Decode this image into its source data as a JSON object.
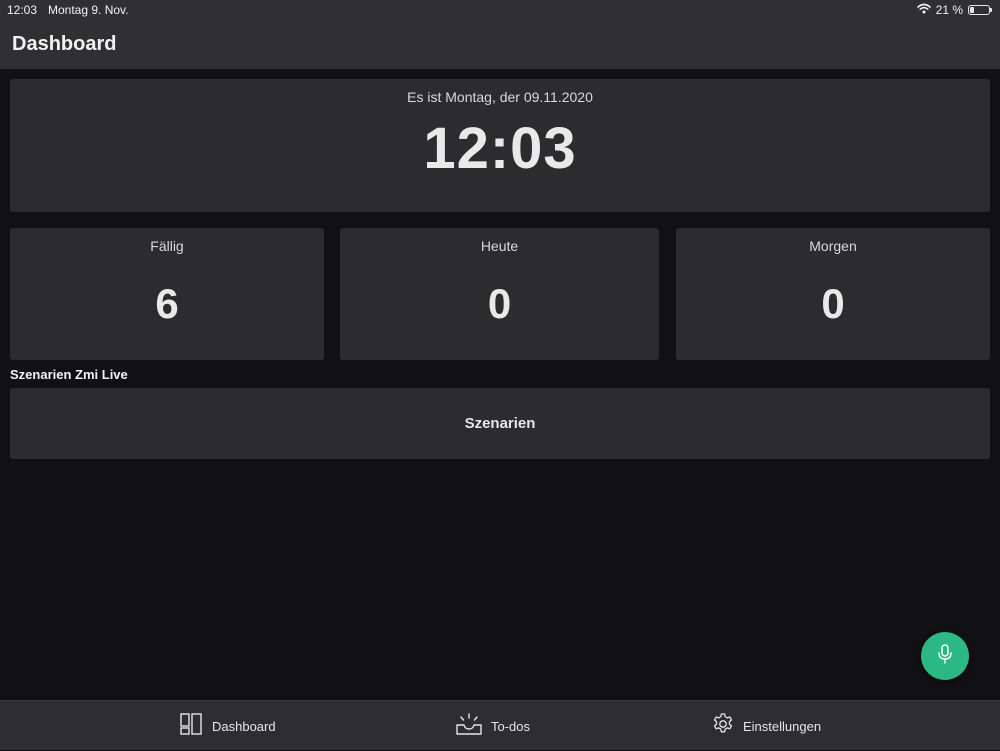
{
  "status_bar": {
    "time": "12:03",
    "date": "Montag 9. Nov.",
    "battery_text": "21 %",
    "battery_level": 0.21
  },
  "header": {
    "title": "Dashboard"
  },
  "clock": {
    "date_text": "Es ist Montag, der 09.11.2020",
    "time": "12:03"
  },
  "stats": [
    {
      "label": "Fällig",
      "value": "6"
    },
    {
      "label": "Heute",
      "value": "0"
    },
    {
      "label": "Morgen",
      "value": "0"
    }
  ],
  "scenarios": {
    "section_title": "Szenarien Zmi Live",
    "button_label": "Szenarien"
  },
  "fab": {
    "icon": "microphone-icon",
    "color": "#2bb885"
  },
  "tabs": [
    {
      "label": "Dashboard",
      "icon": "dashboard-icon"
    },
    {
      "label": "To-dos",
      "icon": "inbox-icon"
    },
    {
      "label": "Einstellungen",
      "icon": "gear-icon"
    }
  ],
  "colors": {
    "background": "#111012",
    "card": "#2c2b2e",
    "bar": "#303032",
    "accent": "#2bb885"
  }
}
